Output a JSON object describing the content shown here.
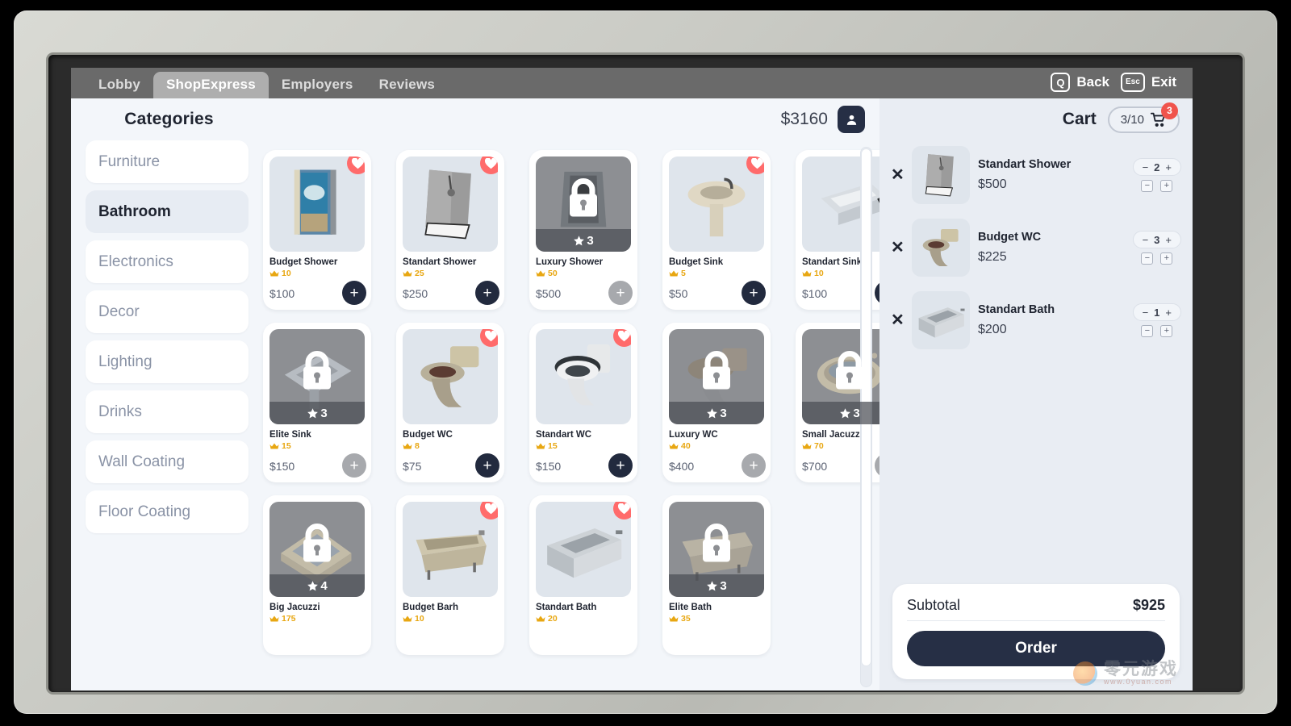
{
  "nav": {
    "tabs": [
      {
        "label": "Lobby",
        "active": false
      },
      {
        "label": "ShopExpress",
        "active": true
      },
      {
        "label": "Employers",
        "active": false
      },
      {
        "label": "Reviews",
        "active": false
      }
    ],
    "back_key": "Q",
    "back_label": "Back",
    "exit_key": "Esc",
    "exit_label": "Exit"
  },
  "shop": {
    "categories_title": "Categories",
    "wallet_amount": "$3160",
    "avatar_icon": "person-icon",
    "categories": [
      {
        "label": "Furniture",
        "active": false
      },
      {
        "label": "Bathroom",
        "active": true
      },
      {
        "label": "Electronics",
        "active": false
      },
      {
        "label": "Decor",
        "active": false
      },
      {
        "label": "Lighting",
        "active": false
      },
      {
        "label": "Drinks",
        "active": false
      },
      {
        "label": "Wall Coating",
        "active": false
      },
      {
        "label": "Floor Coating",
        "active": false
      }
    ],
    "products": [
      {
        "name": "Budget Shower",
        "rep": "10",
        "price": "$100",
        "locked": false,
        "favorite": true,
        "stars": "",
        "art": "shower-budget"
      },
      {
        "name": "Standart Shower",
        "rep": "25",
        "price": "$250",
        "locked": false,
        "favorite": true,
        "stars": "",
        "art": "shower-standart"
      },
      {
        "name": "Luxury Shower",
        "rep": "50",
        "price": "$500",
        "locked": true,
        "favorite": false,
        "stars": "3",
        "art": "shower-luxury"
      },
      {
        "name": "Budget Sink",
        "rep": "5",
        "price": "$50",
        "locked": false,
        "favorite": true,
        "stars": "",
        "art": "sink-budget"
      },
      {
        "name": "Standart Sink",
        "rep": "10",
        "price": "$100",
        "locked": false,
        "favorite": true,
        "stars": "",
        "art": "sink-standart"
      },
      {
        "name": "Elite Sink",
        "rep": "15",
        "price": "$150",
        "locked": true,
        "favorite": false,
        "stars": "3",
        "art": "sink-elite"
      },
      {
        "name": "Budget WC",
        "rep": "8",
        "price": "$75",
        "locked": false,
        "favorite": true,
        "stars": "",
        "art": "wc-budget"
      },
      {
        "name": "Standart WC",
        "rep": "15",
        "price": "$150",
        "locked": false,
        "favorite": true,
        "stars": "",
        "art": "wc-standart"
      },
      {
        "name": "Luxury WC",
        "rep": "40",
        "price": "$400",
        "locked": true,
        "favorite": false,
        "stars": "3",
        "art": "wc-luxury"
      },
      {
        "name": "Small Jacuzzi",
        "rep": "70",
        "price": "$700",
        "locked": true,
        "favorite": false,
        "stars": "3",
        "art": "jacuzzi-small"
      },
      {
        "name": "Big Jacuzzi",
        "rep": "175",
        "price": "",
        "locked": true,
        "favorite": false,
        "stars": "4",
        "art": "jacuzzi-big"
      },
      {
        "name": "Budget Barh",
        "rep": "10",
        "price": "",
        "locked": false,
        "favorite": true,
        "stars": "",
        "art": "bath-budget"
      },
      {
        "name": "Standart Bath",
        "rep": "20",
        "price": "",
        "locked": false,
        "favorite": true,
        "stars": "",
        "art": "bath-standart"
      },
      {
        "name": "Elite Bath",
        "rep": "35",
        "price": "",
        "locked": true,
        "favorite": false,
        "stars": "3",
        "art": "bath-elite"
      }
    ]
  },
  "cart": {
    "title": "Cart",
    "capacity_text": "3/10",
    "badge_count": "3",
    "cart_icon": "shopping-cart-icon",
    "items": [
      {
        "name": "Standart Shower",
        "price": "$500",
        "qty": "2",
        "minus": "−",
        "plus": "+",
        "art": "shower-standart"
      },
      {
        "name": "Budget WC",
        "price": "$225",
        "qty": "3",
        "minus": "−",
        "plus": "+",
        "art": "wc-budget"
      },
      {
        "name": "Standart Bath",
        "price": "$200",
        "qty": "1",
        "minus": "−",
        "plus": "+",
        "art": "bath-standart"
      }
    ],
    "remove_symbol": "✕",
    "subtotal_label": "Subtotal",
    "subtotal_value": "$925",
    "order_label": "Order"
  },
  "watermark": {
    "main": "零元游戏",
    "sub": "www.0yuan.com"
  },
  "colors": {
    "accent_dark": "#262f45",
    "heart": "#ff6b6b",
    "badge": "#f0544c",
    "rep_gold": "#e8a712",
    "locked_overlay": "#8d8f93"
  }
}
